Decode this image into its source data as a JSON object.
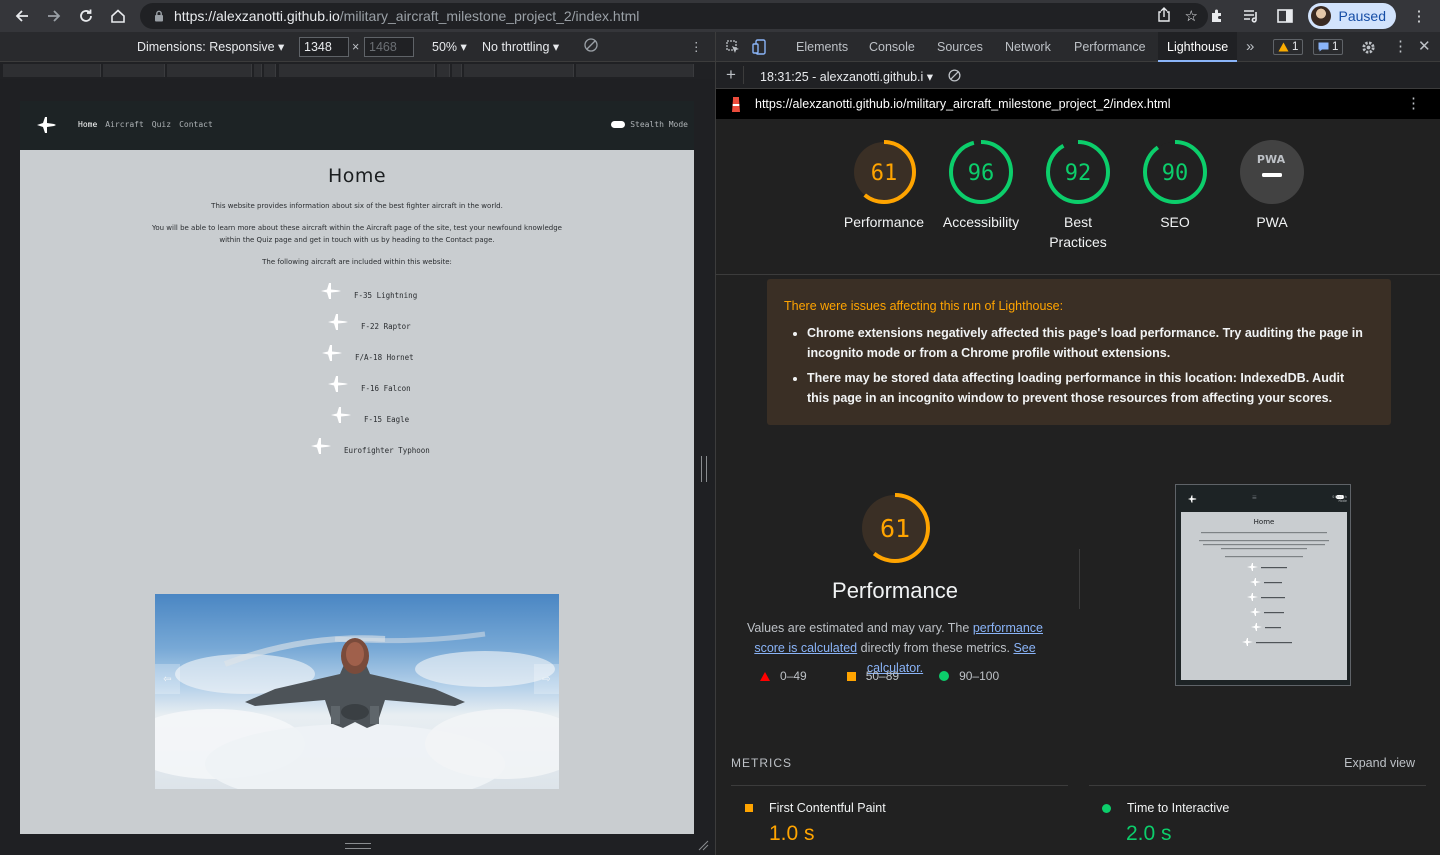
{
  "browser": {
    "url_host": "https://alexzanotti.github.io",
    "url_path": "/military_aircraft_milestone_project_2/index.html",
    "profile_label": "Paused"
  },
  "device_toolbar": {
    "dimensions_label": "Dimensions: Responsive",
    "width_value": "1348",
    "height_placeholder": "1468",
    "times": "×",
    "zoom": "50%",
    "throttling": "No throttling"
  },
  "site": {
    "nav_links": [
      "Home",
      "Aircraft",
      "Quiz",
      "Contact"
    ],
    "stealth_label": "Stealth Mode",
    "heading": "Home",
    "para1": "This website provides information about six of the best fighter aircraft in the world.",
    "para2": "You will be able to learn more about these aircraft within the Aircraft page of the site, test your newfound knowledge within the Quiz page and get in touch with us by heading to the Contact page.",
    "para3": "The following aircraft are included within this website:",
    "aircraft": [
      "F-35 Lightning",
      "F-22 Raptor",
      "F/A-18 Hornet",
      "F-16 Falcon",
      "F-15 Eagle",
      "Eurofighter Typhoon"
    ],
    "carousel_prev": "⇦",
    "carousel_next": "⇨"
  },
  "devtools": {
    "tabs": [
      "Elements",
      "Console",
      "Sources",
      "Network",
      "Performance",
      "Lighthouse"
    ],
    "more_tabs": "»",
    "warning_count": "1",
    "message_count": "1",
    "report_selector": "18:31:25 - alexzanotti.github.i",
    "report_url": "https://alexzanotti.github.io/military_aircraft_milestone_project_2/index.html"
  },
  "lighthouse": {
    "scores": [
      {
        "label": "Performance",
        "value": "61",
        "color": "#ffa400"
      },
      {
        "label": "Accessibility",
        "value": "96",
        "color": "#0cce6b"
      },
      {
        "label": "Best Practices",
        "value": "92",
        "color": "#0cce6b"
      },
      {
        "label": "SEO",
        "value": "90",
        "color": "#0cce6b"
      },
      {
        "label": "PWA",
        "value": "PWA",
        "color": "#9aa0a6"
      }
    ],
    "warning_title": "There were issues affecting this run of Lighthouse:",
    "warnings": [
      "Chrome extensions negatively affected this page's load performance. Try auditing the page in incognito mode or from a Chrome profile without extensions.",
      "There may be stored data affecting loading performance in this location: IndexedDB. Audit this page in an incognito window to prevent those resources from affecting your scores."
    ],
    "perf_score": "61",
    "perf_title": "Performance",
    "perf_desc_1": "Values are estimated and may vary. The ",
    "perf_link_1": "performance score is calculated",
    "perf_desc_2": " directly from these metrics. ",
    "perf_link_2": "See calculator.",
    "legend": [
      "0–49",
      "50–89",
      "90–100"
    ],
    "metrics_heading": "METRICS",
    "expand_view": "Expand view",
    "metrics": [
      {
        "name": "First Contentful Paint",
        "value": "1.0 s",
        "color": "#ffa400"
      },
      {
        "name": "Time to Interactive",
        "value": "2.0 s",
        "color": "#0cce6b"
      }
    ],
    "thumb_heading": "Home",
    "thumb_stealth": "Stealth Mode"
  },
  "colors": {
    "warning": "#ffa400",
    "pass": "#0cce6b",
    "fail": "#ff0000"
  }
}
